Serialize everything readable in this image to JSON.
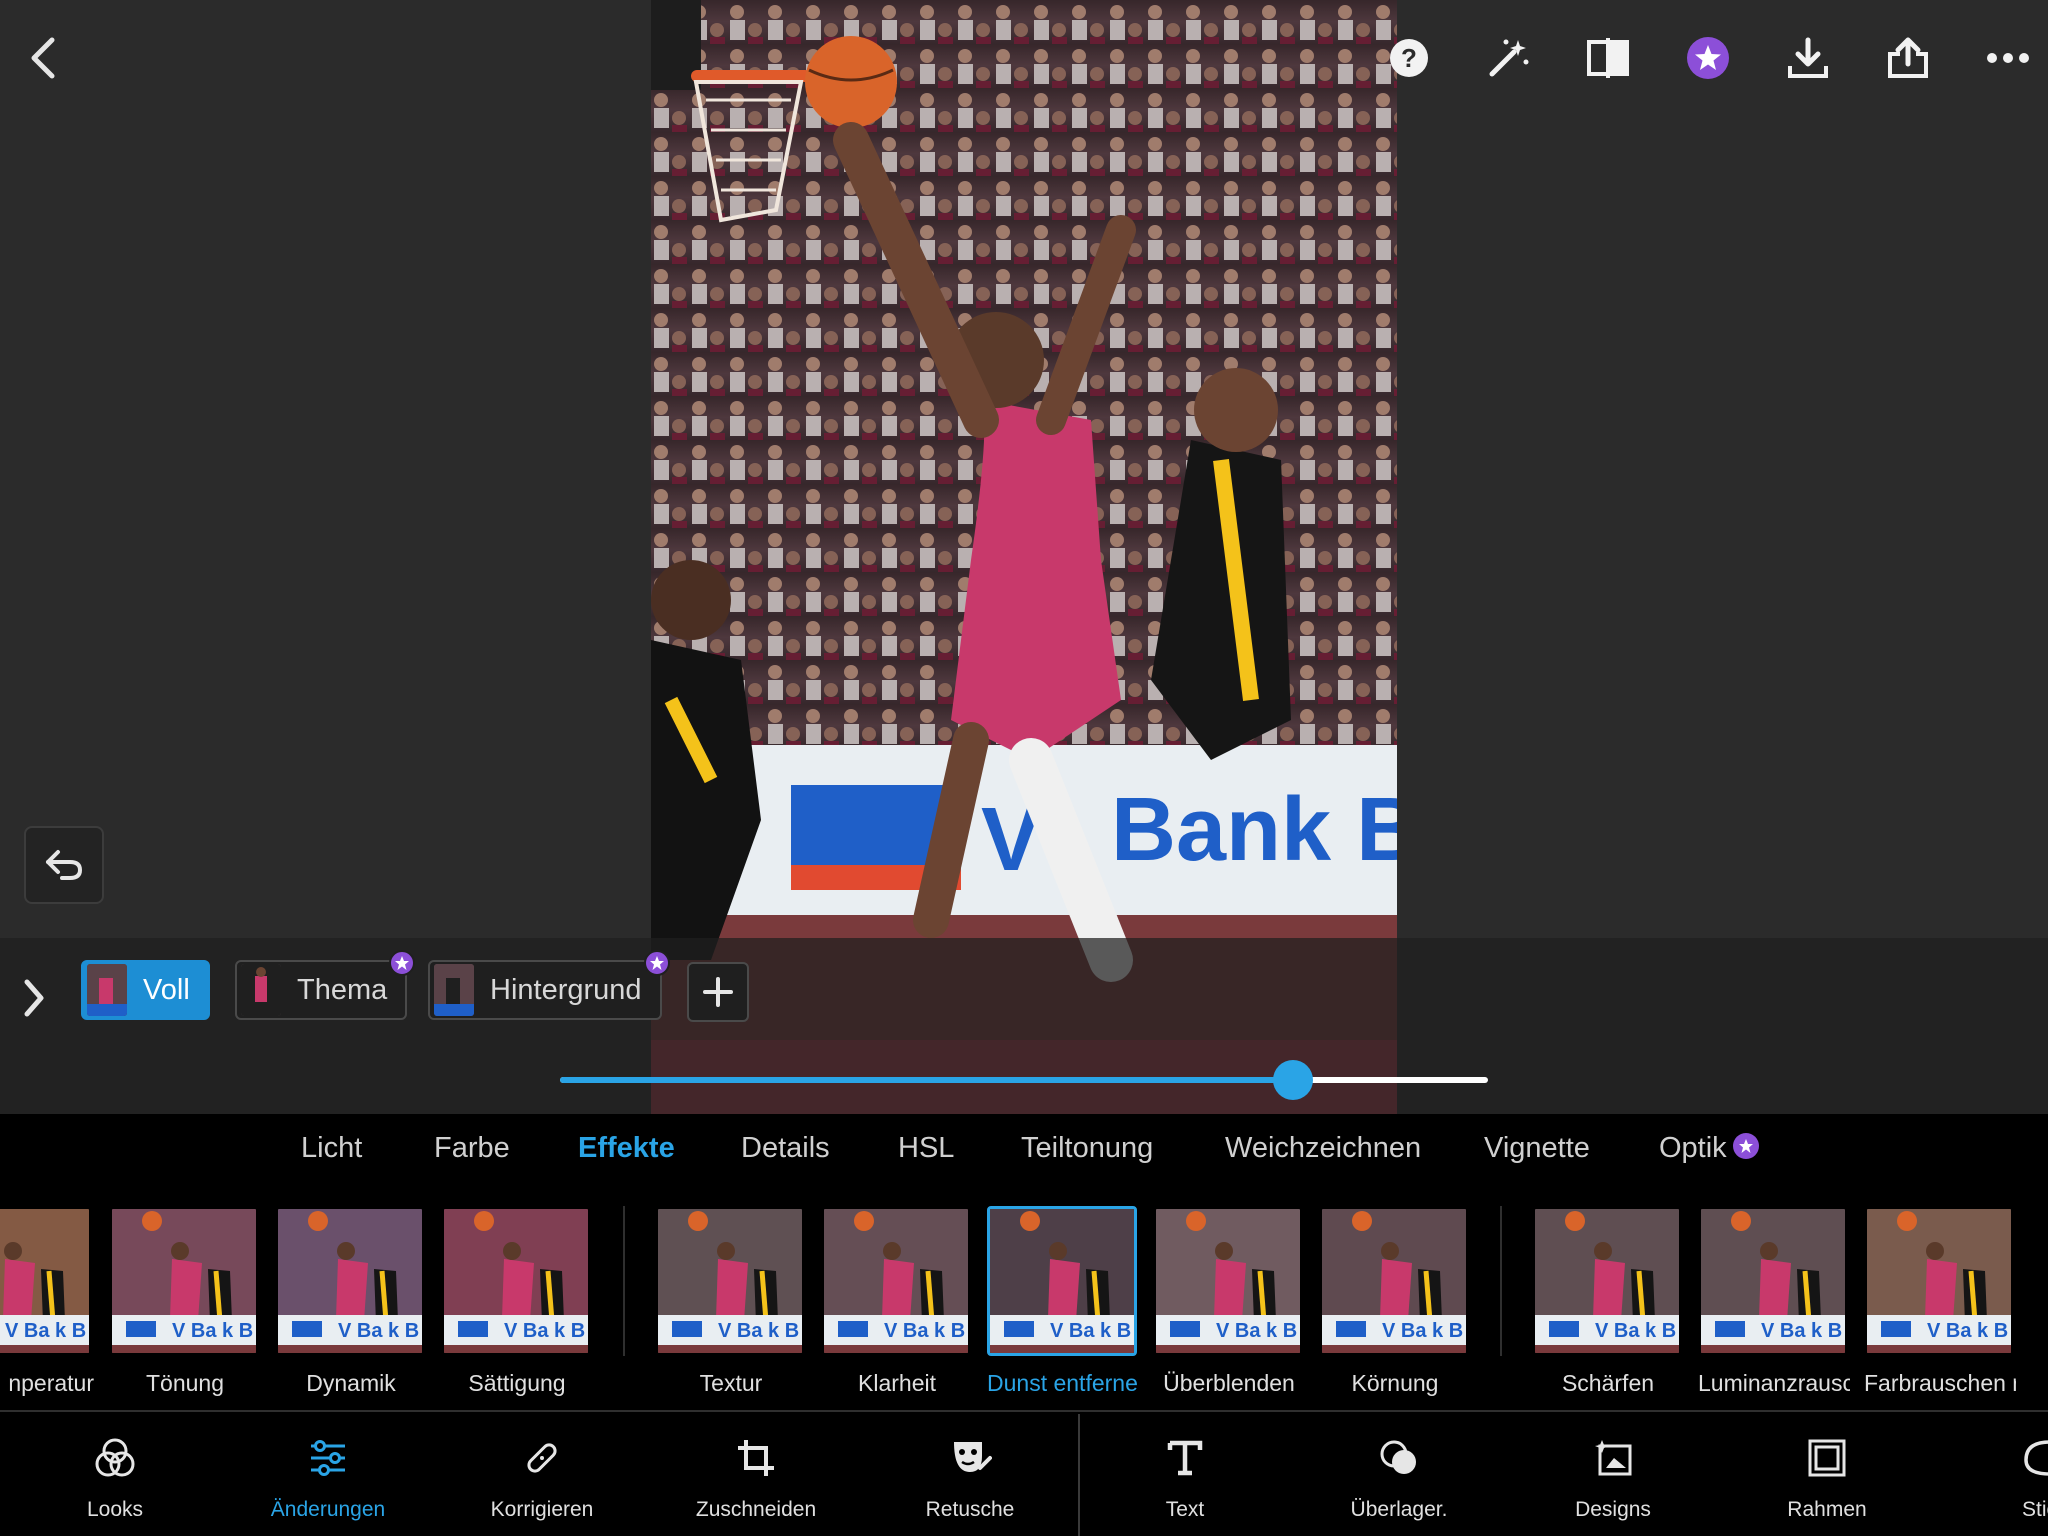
{
  "colors": {
    "accent": "#2aa4e6",
    "premium": "#8c4fd8",
    "background": "#2b2b2b",
    "panel": "#000000"
  },
  "toolbar": {
    "icons": [
      "back-icon",
      "help-icon",
      "magic-wand-icon",
      "compare-icon",
      "premium-star-icon",
      "download-icon",
      "share-icon",
      "more-icon"
    ]
  },
  "masks": {
    "items": [
      {
        "label": "Voll",
        "active": true,
        "premium": false
      },
      {
        "label": "Thema",
        "active": false,
        "premium": true
      },
      {
        "label": "Hintergrund",
        "active": false,
        "premium": true
      }
    ]
  },
  "slider": {
    "value": 0.79
  },
  "categories": {
    "tabs": [
      "Licht",
      "Farbe",
      "Effekte",
      "Details",
      "HSL",
      "Teiltonung",
      "Weichzeichnen",
      "Vignette",
      "Optik"
    ],
    "active": "Effekte"
  },
  "tools": {
    "items": [
      {
        "label": "nperatur"
      },
      {
        "label": "Tönung"
      },
      {
        "label": "Dynamik"
      },
      {
        "label": "Sättigung"
      },
      {
        "label": "Textur"
      },
      {
        "label": "Klarheit"
      },
      {
        "label": "Dunst entferner"
      },
      {
        "label": "Überblenden"
      },
      {
        "label": "Körnung"
      },
      {
        "label": "Schärfen"
      },
      {
        "label": "Luminanzrauscl"
      },
      {
        "label": "Farbrauschen re"
      }
    ],
    "selected": "Dunst entferner"
  },
  "nav": {
    "items": [
      {
        "label": "Looks",
        "icon": "looks-icon"
      },
      {
        "label": "Änderungen",
        "icon": "adjust-sliders-icon",
        "active": true
      },
      {
        "label": "Korrigieren",
        "icon": "bandage-icon"
      },
      {
        "label": "Zuschneiden",
        "icon": "crop-icon"
      },
      {
        "label": "Retusche",
        "icon": "retouch-icon"
      },
      {
        "label": "Text",
        "icon": "text-icon"
      },
      {
        "label": "Überlager.",
        "icon": "overlay-icon"
      },
      {
        "label": "Designs",
        "icon": "designs-icon"
      },
      {
        "label": "Rahmen",
        "icon": "frame-icon"
      },
      {
        "label": "Stic",
        "icon": "sticker-icon"
      }
    ]
  }
}
